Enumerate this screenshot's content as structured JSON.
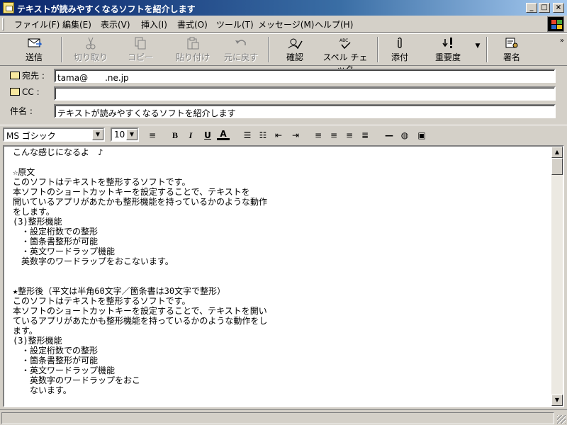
{
  "window": {
    "title": "テキストが読みやすくなるソフトを紹介します",
    "minimize": "_",
    "maximize": "□",
    "close": "×"
  },
  "menu": [
    "ファイル(F)",
    "編集(E)",
    "表示(V)",
    "挿入(I)",
    "書式(O)",
    "ツール(T)",
    "メッセージ(M)",
    "ヘルプ(H)"
  ],
  "toolbar": {
    "send": "送信",
    "cut": "切り取り",
    "copy": "コピー",
    "paste": "貼り付け",
    "undo": "元に戻す",
    "check": "確認",
    "spell": "スペル チェック",
    "attach": "添付",
    "priority": "重要度",
    "sign": "署名",
    "more": "»"
  },
  "header": {
    "to_label": "宛先 :",
    "to_value": "tama@　　.ne.jp",
    "cc_label": "CC :",
    "cc_value": "",
    "subject_label": "件名 :",
    "subject_value": "テキストが読みやすくなるソフトを紹介します"
  },
  "format": {
    "font": "MS ゴシック",
    "size": "10",
    "bold": "B",
    "italic": "I",
    "underline": "U",
    "color": "A"
  },
  "body": [
    "こんな感じになるよ　♪",
    "",
    "☆原文",
    "このソフトはテキストを整形するソフトです。",
    "本ソフトのショートカットキーを設定することで、テキストを",
    "開いているアプリがあたかも整形機能を持っているかのような動作",
    "をします。",
    "(3)整形機能",
    "　・設定桁数での整形",
    "　・箇条書整形が可能",
    "　・英文ワードラップ機能",
    "　英数字のワードラップをおこないます。",
    "",
    "",
    "★整形後（平文は半角60文字／箇条書は30文字で整形）",
    "このソフトはテキストを整形するソフトです。",
    "本ソフトのショートカットキーを設定することで、テキストを開い",
    "ているアプリがあたかも整形機能を持っているかのような動作をし",
    "ます。",
    "(3)整形機能",
    "　・設定桁数での整形",
    "　・箇条書整形が可能",
    "　・英文ワードラップ機能",
    "　　英数字のワードラップをおこ",
    "　　ないます。"
  ],
  "scrollbar": {
    "up": "▲",
    "down": "▼"
  },
  "colors": {
    "title_start": "#0a246a",
    "title_end": "#a6caf0",
    "face": "#d4d0c8"
  }
}
